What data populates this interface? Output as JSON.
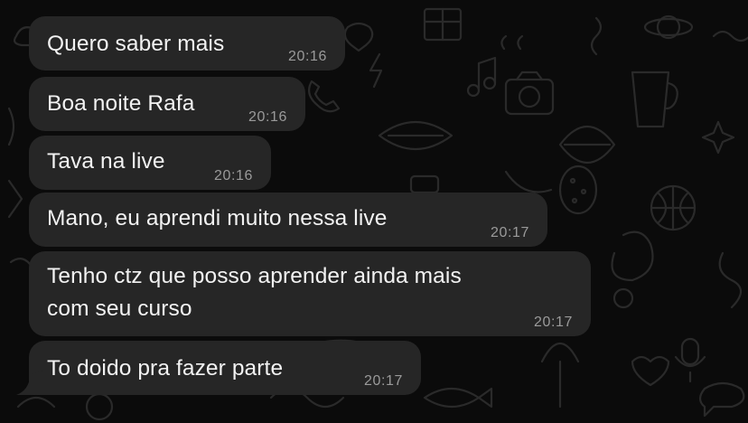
{
  "conversation": {
    "messages": [
      {
        "text": "Quero saber mais",
        "time": "20:16"
      },
      {
        "text": "Boa noite Rafa",
        "time": "20:16"
      },
      {
        "text": "Tava na live",
        "time": "20:16"
      },
      {
        "text": "Mano, eu aprendi muito nessa live",
        "time": "20:17"
      },
      {
        "text_lines": [
          "Tenho ctz que posso aprender ainda mais",
          "com seu curso"
        ],
        "time": "20:17"
      },
      {
        "text": "To doido pra fazer parte",
        "time": "20:17"
      }
    ]
  },
  "theme": {
    "background": "#0b0b0b",
    "bubble": "#262626",
    "text": "#f2f2f2",
    "timestamp": "#9a9a9a",
    "doodle": "#2a2a2a"
  }
}
